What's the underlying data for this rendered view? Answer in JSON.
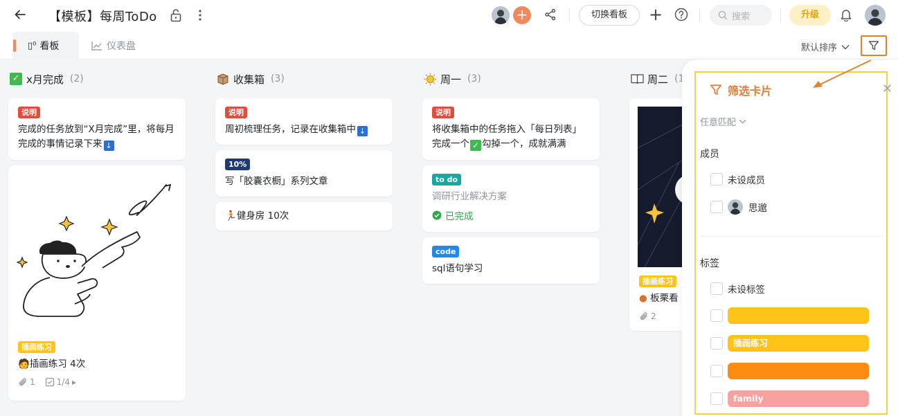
{
  "header": {
    "title": "【模板】每周ToDo",
    "switch_board": "切换看板",
    "search_placeholder": "搜索",
    "upgrade": "升级"
  },
  "tabs": [
    {
      "label": "看板",
      "active": true
    },
    {
      "label": "仪表盘",
      "active": false
    }
  ],
  "toolbar": {
    "sort_label": "默认排序"
  },
  "columns": [
    {
      "title": "x月完成",
      "count": "(2)",
      "cards": [
        {
          "badge": "说明",
          "text": "完成的任务放到“X月完成”里，将每月完成的事情记录下来"
        },
        {
          "tag": "插画练习",
          "text": "插画练习 4次",
          "attachments": "1",
          "checklist": "1/4"
        }
      ]
    },
    {
      "title": "收集箱",
      "count": "(3)",
      "cards": [
        {
          "badge": "说明",
          "text": "周初梳理任务，记录在收集箱中"
        },
        {
          "badge": "10%",
          "text": "写「胶囊衣橱」系列文章"
        },
        {
          "text": "健身房 10次"
        }
      ]
    },
    {
      "title": "周一",
      "count": "(3)",
      "cards": [
        {
          "badge": "说明",
          "text_a": "将收集箱中的任务拖入「每日列表」完成一个",
          "text_b": "勾掉一个，成就满满"
        },
        {
          "badge": "to do",
          "text": "调研行业解决方案",
          "status": "已完成"
        },
        {
          "badge": "code",
          "text": "sql语句学习"
        }
      ]
    },
    {
      "title": "周二",
      "count": "(1",
      "cards": [
        {
          "tag": "插画练习",
          "text": "板栗看",
          "attachments": "2"
        }
      ]
    }
  ],
  "filter_panel": {
    "title": "筛选卡片",
    "match_mode": "任意匹配",
    "members_label": "成员",
    "members": [
      "未设成员",
      "思邈"
    ],
    "tags_label": "标签",
    "tags": [
      {
        "label": "未设标签",
        "color": ""
      },
      {
        "label": "",
        "color": "#fec419"
      },
      {
        "label": "插画练习",
        "color": "#fec419"
      },
      {
        "label": "",
        "color": "#fd8c12"
      },
      {
        "label": "family",
        "color": "#f9a1a1"
      }
    ]
  },
  "colors": {
    "accent": "#f08a5d",
    "filter_highlight": "#e0832a",
    "panel_frame": "#f4d14c"
  }
}
